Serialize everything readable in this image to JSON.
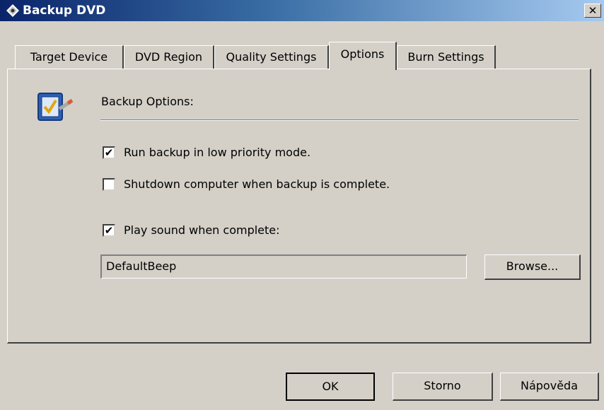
{
  "window": {
    "title": "Backup DVD",
    "close_label": "✕",
    "icon": "disc-icon"
  },
  "tabs": [
    {
      "label": "Target Device",
      "active": false
    },
    {
      "label": "DVD Region",
      "active": false
    },
    {
      "label": "Quality Settings",
      "active": false
    },
    {
      "label": "Options",
      "active": true
    },
    {
      "label": "Burn Settings",
      "active": false
    }
  ],
  "options": {
    "section_label": "Backup Options:",
    "section_icon": "checklist-icon",
    "low_priority": {
      "label": "Run backup in low priority mode.",
      "checked": true
    },
    "shutdown": {
      "label": "Shutdown computer when backup is complete.",
      "checked": false
    },
    "play_sound": {
      "label": "Play sound when complete:",
      "checked": true
    },
    "sound_file": "DefaultBeep",
    "browse_label": "Browse..."
  },
  "buttons": {
    "ok": "OK",
    "cancel": "Storno",
    "help": "Nápověda"
  },
  "colors": {
    "face": "#d4d0c8",
    "title_start": "#0a246a",
    "title_end": "#a6caf0"
  }
}
